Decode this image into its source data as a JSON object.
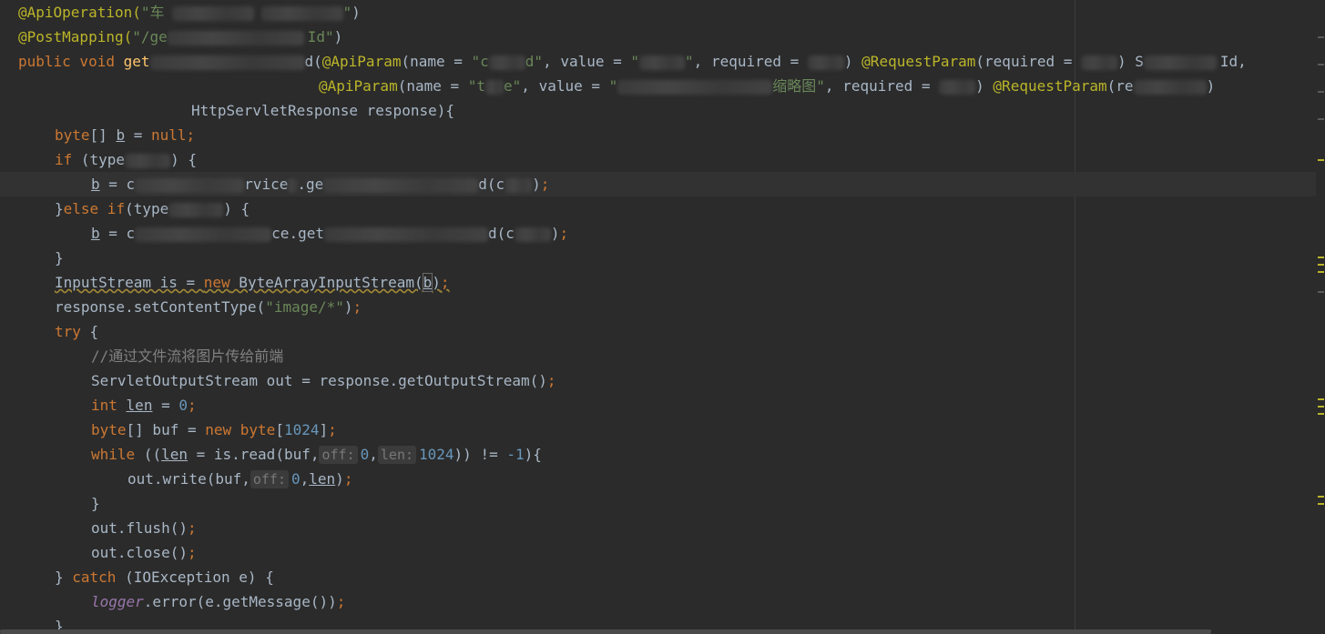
{
  "code": {
    "l1_ann": "@ApiOperation(",
    "l1_str": "\"车",
    "l1_str_end": "\"",
    "l1_end": ")",
    "l2_ann": "@PostMapping(",
    "l2_str": "\"/ge",
    "l2_str_end": "Id\"",
    "l2_end": ")",
    "l3_kw": "public void ",
    "l3_name": "get",
    "l3_d": "d(",
    "l3_ann1": "@ApiParam",
    "l3_args1": "(name = ",
    "l3_s1": "\"c",
    "l3_s1b": "d\"",
    "l3_args2": ", value = ",
    "l3_s2": "\"",
    "l3_s2b": "\"",
    "l3_args3": ", required = ",
    "l3_paren": ") ",
    "l3_ann2": "@RequestParam",
    "l3_args4": "(required = ",
    "l3_paren2": ") S",
    "l3_id": "Id,",
    "l4_ann1": "@ApiParam",
    "l4_args1": "(name = ",
    "l4_s1": "\"t",
    "l4_s1b": "e\"",
    "l4_args2": ", value = ",
    "l4_s2": "\"",
    "l4_s2b": "缩略图",
    "l4_s2c": "\"",
    "l4_args3": ", required = ",
    "l4_paren": ") ",
    "l4_ann2": "@RequestParam",
    "l4_args4": "(re",
    "l4_end": ")",
    "l5": "HttpServletResponse response){",
    "l6_kw": "byte",
    "l6_a": "[] ",
    "l6_var": "b",
    "l6_b": " = ",
    "l6_null": "null",
    "l6_semi": ";",
    "l7_kw": "if",
    "l7_a": " (type",
    "l7_b": ") {",
    "l8_var": "b",
    "l8_a": " = c",
    "l8_b": "rvice",
    "l8_c": ".ge",
    "l8_d": "d(c",
    "l8_e": ")",
    "l8_semi": ";",
    "l9_a": "}",
    "l9_kw": "else if",
    "l9_b": "(type",
    "l9_c": ") {",
    "l10_var": "b",
    "l10_a": " = c",
    "l10_b": "ce.get",
    "l10_c": "d(c",
    "l10_d": ")",
    "l10_semi": ";",
    "l11": "}",
    "l12_a": "InputStream is = ",
    "l12_kw": "new",
    "l12_b": " ByteArrayInputStream(",
    "l12_var": "b",
    "l12_c": ")",
    "l12_semi": ";",
    "l13_a": "response.setContentType(",
    "l13_str": "\"image/*\"",
    "l13_b": ")",
    "l13_semi": ";",
    "l14_kw": "try",
    "l14_a": " {",
    "l15_cmt": "//通过文件流将图片传给前端",
    "l16_a": "ServletOutputStream out = response.getOutputStream()",
    "l16_semi": ";",
    "l17_kw": "int",
    "l17_var": "len",
    "l17_a": " = ",
    "l17_num": "0",
    "l17_semi": ";",
    "l18_kw": "byte",
    "l18_a": "[] buf = ",
    "l18_kw2": "new",
    "l18_kw3": "byte",
    "l18_b": "[",
    "l18_num": "1024",
    "l18_c": "]",
    "l18_semi": ";",
    "l19_kw": "while",
    "l19_a": " ((",
    "l19_var": "len",
    "l19_b": " = is.read(buf,",
    "l19_hint1": "off:",
    "l19_num1": "0",
    "l19_c": ",",
    "l19_hint2": "len:",
    "l19_num2": "1024",
    "l19_d": ")) != ",
    "l19_num3": "-1",
    "l19_e": "){",
    "l20_a": "out.write(buf,",
    "l20_hint": "off:",
    "l20_num": "0",
    "l20_b": ",",
    "l20_var": "len",
    "l20_c": ")",
    "l20_semi": ";",
    "l21": "}",
    "l22_a": "out.flush()",
    "l22_semi": ";",
    "l23_a": "out.close()",
    "l23_semi": ";",
    "l24_a": "} ",
    "l24_kw": "catch",
    "l24_b": " (IOException e) {",
    "l25_fld": "logger",
    "l25_a": ".error(e.getMessage())",
    "l25_semi": ";",
    "l26": "}"
  },
  "colors": {
    "background": "#2b2b2b",
    "text": "#a9b7c6",
    "keyword": "#cc7832",
    "string": "#6a8759",
    "annotation": "#bbb529",
    "number": "#6897bb",
    "comment": "#808080"
  }
}
